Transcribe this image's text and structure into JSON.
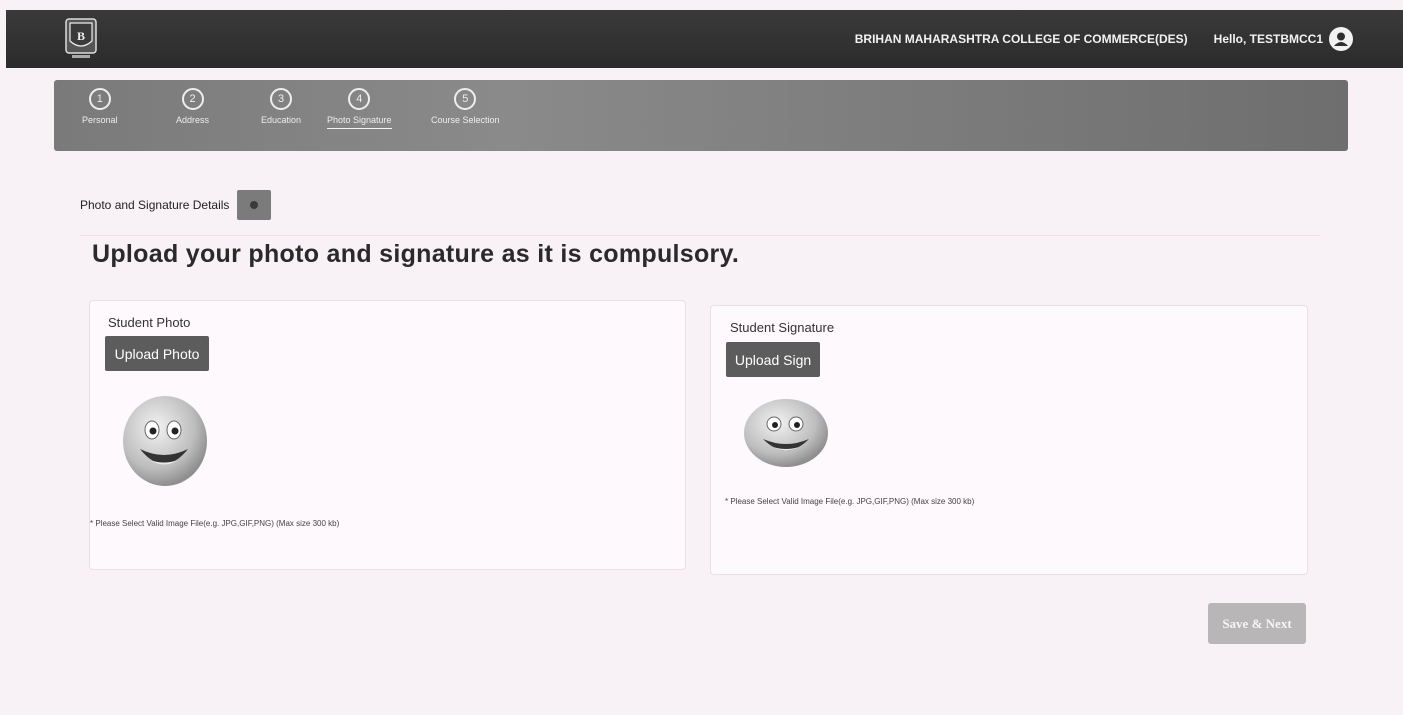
{
  "header": {
    "college_name": "BRIHAN MAHARASHTRA COLLEGE OF COMMERCE(DES)",
    "greeting": "Hello, TESTBMCC1"
  },
  "steps": [
    {
      "number": "1",
      "label": "Personal"
    },
    {
      "number": "2",
      "label": "Address"
    },
    {
      "number": "3",
      "label": "Education"
    },
    {
      "number": "4",
      "label": "Photo Signature"
    },
    {
      "number": "5",
      "label": "Course Selection"
    }
  ],
  "active_step": "Photo Signature",
  "section": {
    "heading": "Photo and Signature Details",
    "title": "Upload your photo and signature as it is compulsory."
  },
  "photo_card": {
    "label": "Student Photo",
    "button": "Upload Photo",
    "hint": "* Please Select Valid Image File(e.g. JPG,GIF,PNG) (Max size 300 kb)"
  },
  "sign_card": {
    "label": "Student Signature",
    "button": "Upload Sign",
    "hint": "* Please Select Valid Image File(e.g. JPG,GIF,PNG) (Max size 300 kb)"
  },
  "actions": {
    "save_next": "Save & Next"
  },
  "colors": {
    "topbar": "#2f2f2f",
    "stepbar": "#7f7f7f",
    "button": "#5c5c5c",
    "save_disabled": "#b9b6b8"
  }
}
